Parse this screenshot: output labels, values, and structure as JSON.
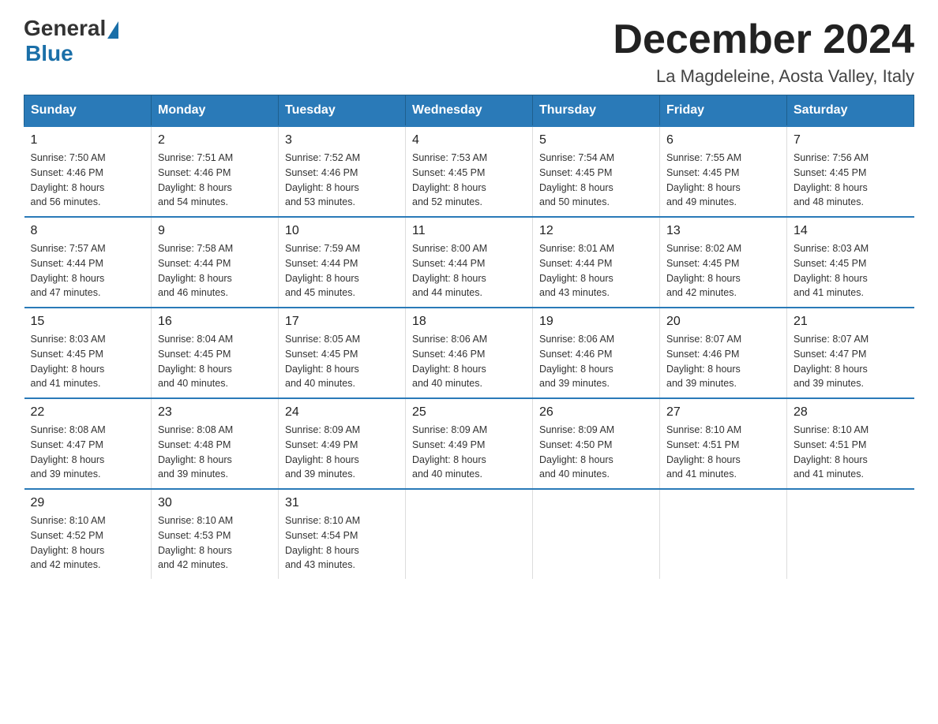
{
  "logo": {
    "text_general": "General",
    "text_blue": "Blue"
  },
  "title": "December 2024",
  "subtitle": "La Magdeleine, Aosta Valley, Italy",
  "days_of_week": [
    "Sunday",
    "Monday",
    "Tuesday",
    "Wednesday",
    "Thursday",
    "Friday",
    "Saturday"
  ],
  "weeks": [
    [
      {
        "day": "1",
        "sunrise": "7:50 AM",
        "sunset": "4:46 PM",
        "daylight": "8 hours and 56 minutes."
      },
      {
        "day": "2",
        "sunrise": "7:51 AM",
        "sunset": "4:46 PM",
        "daylight": "8 hours and 54 minutes."
      },
      {
        "day": "3",
        "sunrise": "7:52 AM",
        "sunset": "4:46 PM",
        "daylight": "8 hours and 53 minutes."
      },
      {
        "day": "4",
        "sunrise": "7:53 AM",
        "sunset": "4:45 PM",
        "daylight": "8 hours and 52 minutes."
      },
      {
        "day": "5",
        "sunrise": "7:54 AM",
        "sunset": "4:45 PM",
        "daylight": "8 hours and 50 minutes."
      },
      {
        "day": "6",
        "sunrise": "7:55 AM",
        "sunset": "4:45 PM",
        "daylight": "8 hours and 49 minutes."
      },
      {
        "day": "7",
        "sunrise": "7:56 AM",
        "sunset": "4:45 PM",
        "daylight": "8 hours and 48 minutes."
      }
    ],
    [
      {
        "day": "8",
        "sunrise": "7:57 AM",
        "sunset": "4:44 PM",
        "daylight": "8 hours and 47 minutes."
      },
      {
        "day": "9",
        "sunrise": "7:58 AM",
        "sunset": "4:44 PM",
        "daylight": "8 hours and 46 minutes."
      },
      {
        "day": "10",
        "sunrise": "7:59 AM",
        "sunset": "4:44 PM",
        "daylight": "8 hours and 45 minutes."
      },
      {
        "day": "11",
        "sunrise": "8:00 AM",
        "sunset": "4:44 PM",
        "daylight": "8 hours and 44 minutes."
      },
      {
        "day": "12",
        "sunrise": "8:01 AM",
        "sunset": "4:44 PM",
        "daylight": "8 hours and 43 minutes."
      },
      {
        "day": "13",
        "sunrise": "8:02 AM",
        "sunset": "4:45 PM",
        "daylight": "8 hours and 42 minutes."
      },
      {
        "day": "14",
        "sunrise": "8:03 AM",
        "sunset": "4:45 PM",
        "daylight": "8 hours and 41 minutes."
      }
    ],
    [
      {
        "day": "15",
        "sunrise": "8:03 AM",
        "sunset": "4:45 PM",
        "daylight": "8 hours and 41 minutes."
      },
      {
        "day": "16",
        "sunrise": "8:04 AM",
        "sunset": "4:45 PM",
        "daylight": "8 hours and 40 minutes."
      },
      {
        "day": "17",
        "sunrise": "8:05 AM",
        "sunset": "4:45 PM",
        "daylight": "8 hours and 40 minutes."
      },
      {
        "day": "18",
        "sunrise": "8:06 AM",
        "sunset": "4:46 PM",
        "daylight": "8 hours and 40 minutes."
      },
      {
        "day": "19",
        "sunrise": "8:06 AM",
        "sunset": "4:46 PM",
        "daylight": "8 hours and 39 minutes."
      },
      {
        "day": "20",
        "sunrise": "8:07 AM",
        "sunset": "4:46 PM",
        "daylight": "8 hours and 39 minutes."
      },
      {
        "day": "21",
        "sunrise": "8:07 AM",
        "sunset": "4:47 PM",
        "daylight": "8 hours and 39 minutes."
      }
    ],
    [
      {
        "day": "22",
        "sunrise": "8:08 AM",
        "sunset": "4:47 PM",
        "daylight": "8 hours and 39 minutes."
      },
      {
        "day": "23",
        "sunrise": "8:08 AM",
        "sunset": "4:48 PM",
        "daylight": "8 hours and 39 minutes."
      },
      {
        "day": "24",
        "sunrise": "8:09 AM",
        "sunset": "4:49 PM",
        "daylight": "8 hours and 39 minutes."
      },
      {
        "day": "25",
        "sunrise": "8:09 AM",
        "sunset": "4:49 PM",
        "daylight": "8 hours and 40 minutes."
      },
      {
        "day": "26",
        "sunrise": "8:09 AM",
        "sunset": "4:50 PM",
        "daylight": "8 hours and 40 minutes."
      },
      {
        "day": "27",
        "sunrise": "8:10 AM",
        "sunset": "4:51 PM",
        "daylight": "8 hours and 41 minutes."
      },
      {
        "day": "28",
        "sunrise": "8:10 AM",
        "sunset": "4:51 PM",
        "daylight": "8 hours and 41 minutes."
      }
    ],
    [
      {
        "day": "29",
        "sunrise": "8:10 AM",
        "sunset": "4:52 PM",
        "daylight": "8 hours and 42 minutes."
      },
      {
        "day": "30",
        "sunrise": "8:10 AM",
        "sunset": "4:53 PM",
        "daylight": "8 hours and 42 minutes."
      },
      {
        "day": "31",
        "sunrise": "8:10 AM",
        "sunset": "4:54 PM",
        "daylight": "8 hours and 43 minutes."
      },
      null,
      null,
      null,
      null
    ]
  ],
  "labels": {
    "sunrise": "Sunrise:",
    "sunset": "Sunset:",
    "daylight": "Daylight:"
  }
}
